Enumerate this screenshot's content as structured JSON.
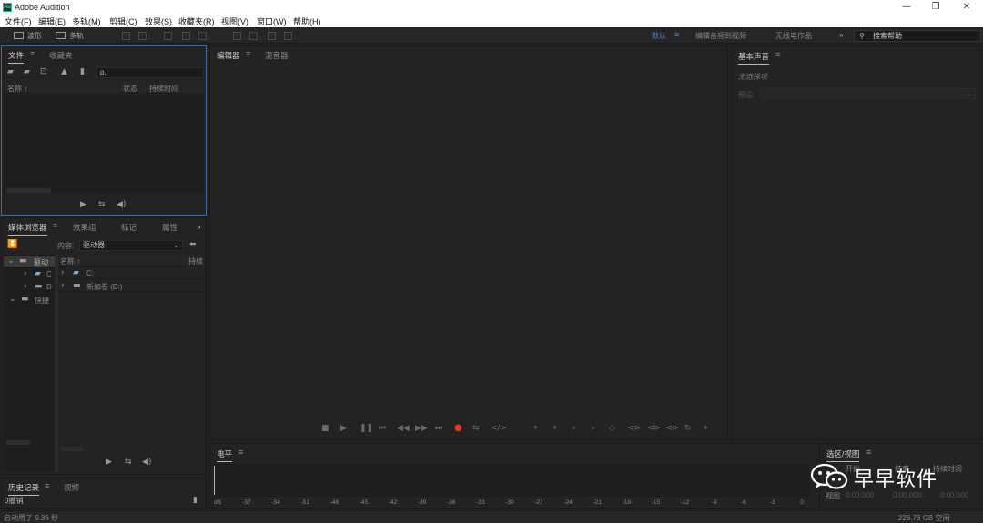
{
  "window": {
    "title": "Adobe Audition",
    "app_icon_text": "Au",
    "controls": [
      "—",
      "❐",
      "✕"
    ]
  },
  "menu": [
    "文件(F)",
    "编辑(E)",
    "多轨(M)",
    "剪辑(C)",
    "效果(S)",
    "收藏夹(R)",
    "视图(V)",
    "窗口(W)",
    "帮助(H)"
  ],
  "toolbar": {
    "mode_waveform": "波形",
    "mode_multitrack": "多轨",
    "workspaces": [
      "默认",
      "编辑音频到视频",
      "无线电作品"
    ],
    "more": "»",
    "search_placeholder": "搜索帮助"
  },
  "files_panel": {
    "tabs": [
      "文件",
      "收藏夹"
    ],
    "menu_glyph": "≡",
    "search_prefix": "ρ.",
    "columns": [
      "名称 ↑",
      "状态",
      "持续时间"
    ]
  },
  "media_panel": {
    "tabs": [
      "媒体浏览器",
      "效果组",
      "标记",
      "属性"
    ],
    "more": "»",
    "content_label": "内容:",
    "content_value": "驱动器",
    "columns": [
      "名称 ↑",
      "持续"
    ],
    "tree": [
      "驱动",
      "C",
      "D",
      "快捷"
    ],
    "drives": [
      "C:",
      "新加卷 (D:)"
    ]
  },
  "editor_panel": {
    "tabs": [
      "编辑器",
      "混音器"
    ]
  },
  "essential_sound": {
    "title": "基本声音",
    "no_selection": "无选择项",
    "preset_label": "预设:"
  },
  "history_panel": {
    "tabs": [
      "历史记录",
      "视频"
    ],
    "undo_text": "0撤销"
  },
  "level_panel": {
    "title": "电平",
    "scale": [
      "dB",
      "-57",
      "-54",
      "-51",
      "-48",
      "-45",
      "-42",
      "-39",
      "-36",
      "-33",
      "-30",
      "-27",
      "-24",
      "-21",
      "-18",
      "-15",
      "-12",
      "-9",
      "-6",
      "-3",
      "0"
    ]
  },
  "selection_panel": {
    "title": "选区/视图",
    "start_label": "开始",
    "end_label": "结束",
    "duration_label": "持续时间",
    "view_label": "视图",
    "value": "0:00.000"
  },
  "status": {
    "left": "启动用了 9.36 秒",
    "right": "226.73 GB 空闲"
  },
  "watermark": {
    "text": "早早软件"
  },
  "colors": {
    "accent": "#4b8fe0",
    "record": "#e8342e",
    "background": "#232323",
    "meter_cursor": "#c8c832"
  }
}
